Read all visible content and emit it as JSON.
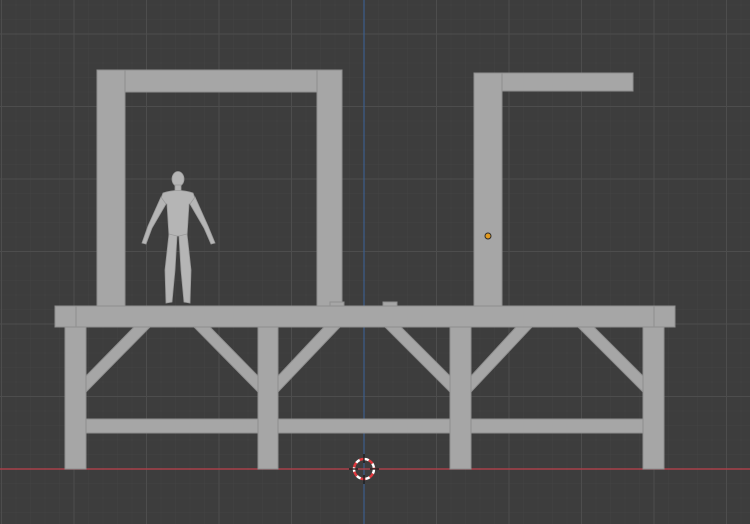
{
  "viewport": {
    "view": "front-orthographic",
    "background_color": "#3d3d3d",
    "grid_major_color": "#4d4d4d",
    "grid_minor_color": "#444444",
    "x_axis_color": "#a8404a",
    "z_axis_color": "#3c5e8c",
    "mesh_color": "#a6a6a6",
    "mesh_edge_color": "#8f8f8f"
  },
  "scene": {
    "objects": [
      "platform-mesh",
      "frame-left-mesh",
      "frame-right-mesh",
      "human-reference-figure"
    ],
    "origin_marker_color": "#e39a1e",
    "cursor_icon": "3d-cursor-icon"
  }
}
